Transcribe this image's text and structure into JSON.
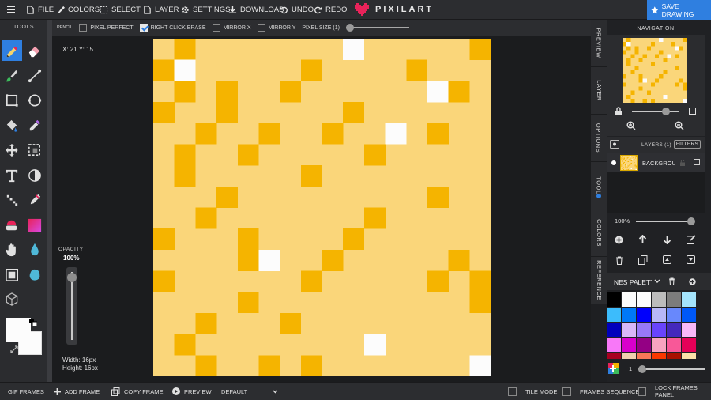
{
  "topbar": {
    "menu": {
      "file": "FILE",
      "colors": "COLORS",
      "select": "SELECT",
      "layer": "LAYER",
      "settings": "SETTINGS",
      "download": "DOWNLOAD",
      "undo": "UNDO",
      "redo": "REDO"
    },
    "logo_text": "PIXILART",
    "save_label": "SAVE DRAWING"
  },
  "tools": {
    "title": "TOOLS",
    "items": [
      "pencil-icon",
      "eraser-icon",
      "brush-icon",
      "line-icon",
      "rectangle-icon",
      "ellipse-icon",
      "bucket-fill-icon",
      "eyedropper-icon",
      "move-icon",
      "select-icon",
      "text-icon",
      "dither-icon",
      "pixel-brush-icon",
      "pipette-icon",
      "color-replace-icon",
      "gradient-icon",
      "hand-icon",
      "water-drop-icon",
      "crop-icon",
      "blob-icon",
      "cube-icon"
    ],
    "active": "pencil-icon"
  },
  "options_bar": {
    "tool_name": "PENCIL:",
    "pixel_perfect": {
      "label": "PIXEL PERFECT",
      "checked": false
    },
    "right_click_erase": {
      "label": "RIGHT CLICK ERASE",
      "checked": true
    },
    "mirror_x": {
      "label": "MIRROR X",
      "checked": false
    },
    "mirror_y": {
      "label": "MIRROR Y",
      "checked": false
    },
    "pixel_size": {
      "label": "PIXEL SIZE (1)",
      "value": 1
    }
  },
  "workspace": {
    "coords": "X: 21 Y: 15",
    "opacity_label": "OPACITY",
    "opacity_value": "100%",
    "width_label": "Width: 16px",
    "height_label": "Height: 16px"
  },
  "colors": {
    "bg": "#fad67a",
    "dark": "#f5b400",
    "light": "#fcfcfc",
    "accent": "#2f7fe0",
    "primary": "#fcfcfc",
    "secondary": "#fcfcfc"
  },
  "canvas_pixels": [
    "0D0000000W00000D",
    "DW00000D0000D000",
    "0D0D00D000000WD0",
    "D00D00000D000000",
    "00D00D00D00W0D00",
    "0D00D00000D00000",
    "0D00000D00000000",
    "000D000000000D00",
    "00D0000000D00000",
    "D000D0000D000000",
    "0000DW00D00000D0",
    "D000000D00000D0D",
    "0000D0000000000D",
    "00D000D000000000",
    "0D00000000W00000",
    "00D00D0D0000000W",
    "0D000000000000D0"
  ],
  "right_tabs": [
    "PREVIEW",
    "LAYER",
    "OPTIONS",
    "TOOL",
    "COLORS",
    "REFERENCE"
  ],
  "navigation": {
    "title": "NAVIGATION"
  },
  "layers": {
    "title": "LAYERS (1)",
    "filters_label": "FILTERS",
    "items": [
      {
        "name": "BACKGROUND"
      }
    ],
    "opacity": "100%"
  },
  "palette": {
    "name": "NES PALETTE",
    "size_value": "1",
    "swatches": [
      "#000000",
      "#fcfcfc",
      "#fcfcfc",
      "#bcbcbc",
      "#7c7c7c",
      "#a4e4fc",
      "#3cbcfc",
      "#0078f8",
      "#0000fc",
      "#b8b8f8",
      "#6888fc",
      "#0058f8",
      "#0000bc",
      "#d8b8f8",
      "#9878f8",
      "#6844fc",
      "#4428bc",
      "#f8b8f8",
      "#f878f8",
      "#d800cc",
      "#940084",
      "#f8a4c0",
      "#f85898",
      "#e40058",
      "#a80020",
      "#f0d0b0",
      "#f87858",
      "#f83800",
      "#a81000",
      "#fce0a8"
    ]
  },
  "bottombar": {
    "gif_frames": "GIF FRAMES",
    "add_frame": "ADD FRAME",
    "copy_frame": "COPY FRAME",
    "preview": "PREVIEW",
    "speed": "DEFAULT",
    "tile_mode": "TILE MODE",
    "frames_sequence": "FRAMES SEQUENCE",
    "lock_frames_panel": "LOCK FRAMES PANEL"
  }
}
